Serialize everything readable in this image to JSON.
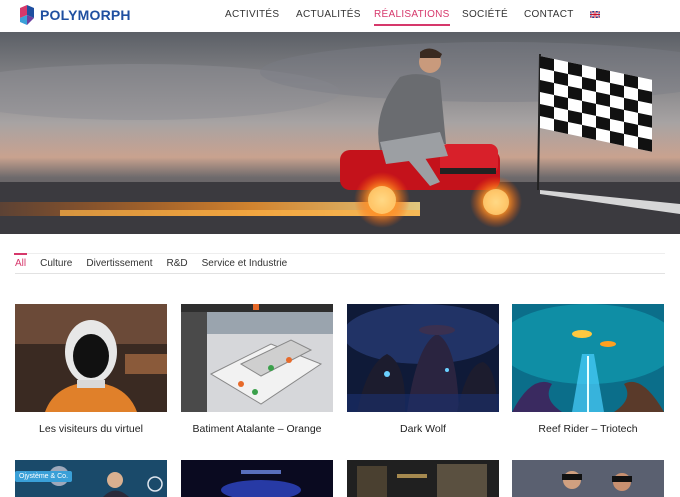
{
  "brand": {
    "name": "POLYMORPH"
  },
  "nav": {
    "items": [
      {
        "label": "ACTIVITÉS"
      },
      {
        "label": "ACTUALITÉS"
      },
      {
        "label": "RÉALISATIONS"
      },
      {
        "label": "SOCIÉTÉ"
      },
      {
        "label": "CONTACT"
      }
    ],
    "language_icon": "uk-flag-icon"
  },
  "filters": {
    "items": [
      "All",
      "Culture",
      "Divertissement",
      "R&D",
      "Service et Industrie"
    ],
    "selected": "All"
  },
  "projects": [
    {
      "title": "Les visiteurs du virtuel"
    },
    {
      "title": "Batiment Atalante – Orange"
    },
    {
      "title": "Dark Wolf"
    },
    {
      "title": "Reef Rider – Triotech"
    }
  ],
  "second_row": {
    "tag_label": "Ojystème & Co."
  },
  "colors": {
    "accent": "#d6386b",
    "brand_blue": "#1f4fa0"
  }
}
